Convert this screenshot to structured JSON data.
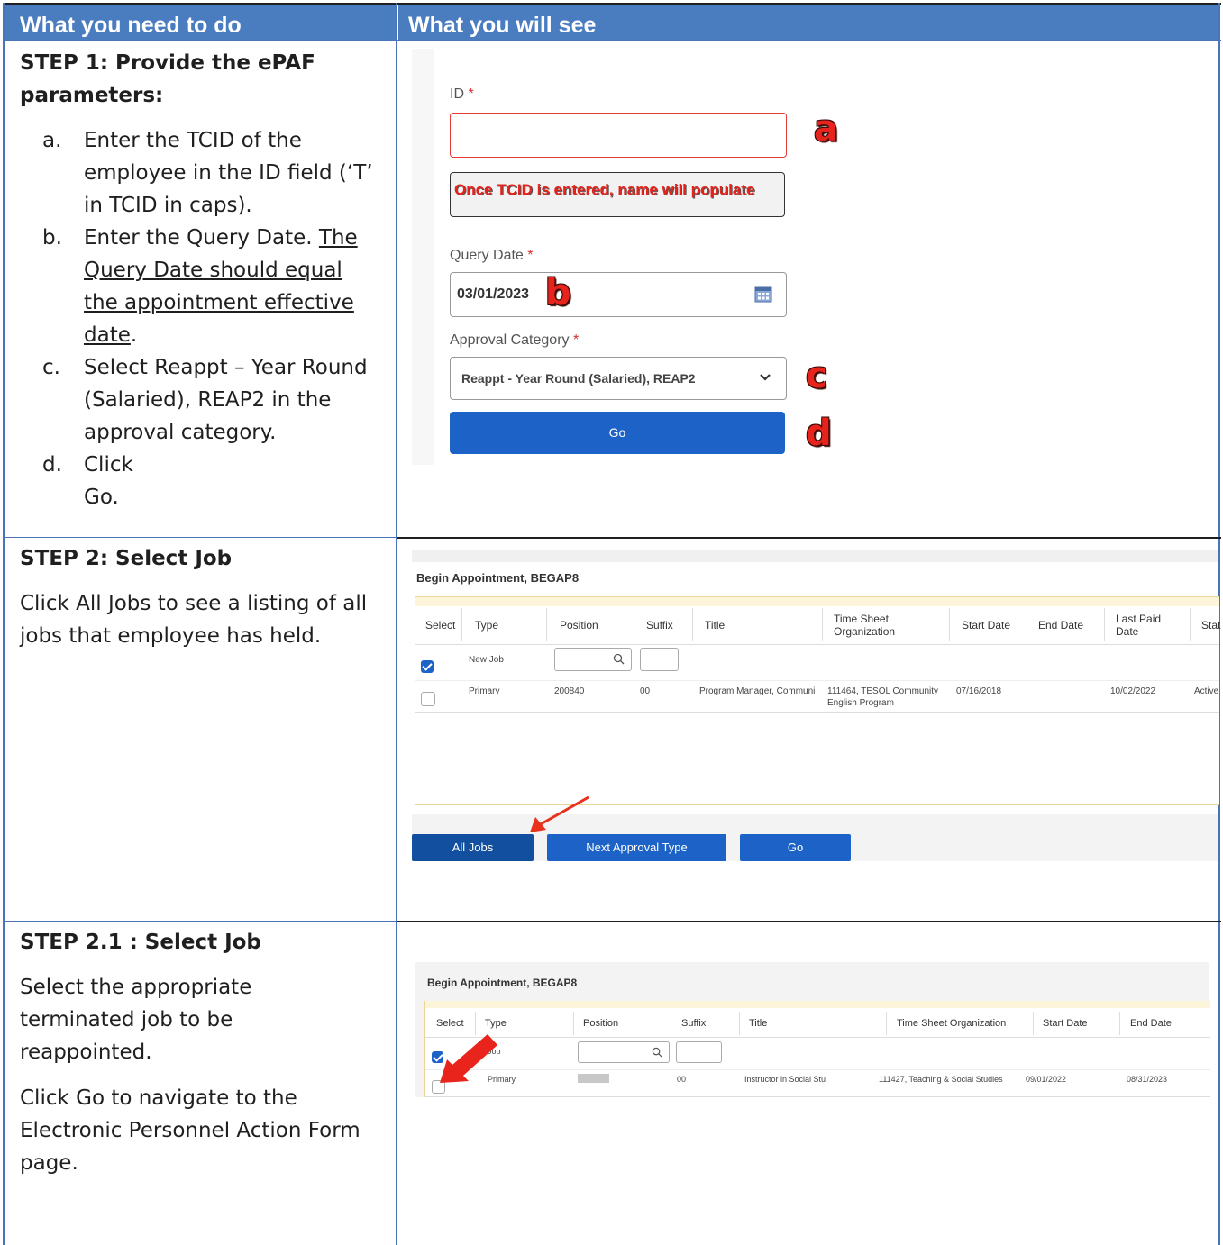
{
  "header": {
    "col1": "What you need to do",
    "col2": "What you will see"
  },
  "step1": {
    "title_line1": "STEP 1: Provide the ePAF",
    "title_line2": "parameters:",
    "items": [
      {
        "marker": "a.",
        "lines": [
          "Enter the TCID of the",
          "employee in the ID field (‘T’",
          "in TCID in caps)."
        ]
      },
      {
        "marker": "b.",
        "plain": "Enter the Query Date. ",
        "underlined": [
          "The",
          "Query Date should equal",
          "the appointment effective",
          "date"
        ],
        "end": "."
      },
      {
        "marker": "c.",
        "lines": [
          "Select Reappt – Year Round",
          "(Salaried), REAP2 in the",
          "approval category."
        ]
      },
      {
        "marker": "d.",
        "lines": [
          "Click Go."
        ]
      }
    ],
    "form": {
      "id_label": "ID",
      "required_mark": "*",
      "callout": "Once TCID is entered, name will populate",
      "query_date_label": "Query Date",
      "query_date_value": "03/01/2023",
      "approval_label": "Approval Category",
      "approval_value": "Reappt - Year Round (Salaried), REAP2",
      "go_label": "Go",
      "letters": [
        "a",
        "b",
        "c",
        "d"
      ],
      "icons": [
        "calendar-icon",
        "chevron-down-icon"
      ]
    }
  },
  "step2": {
    "title": "STEP 2: Select Job",
    "lines": [
      "Click All Jobs to see a listing of all",
      "jobs that employee has held."
    ],
    "screen": {
      "heading": "Begin Appointment, BEGAP8",
      "columns": [
        "Select",
        "Type",
        "Position",
        "Suffix",
        "Title",
        "Time Sheet",
        "Organization",
        "Start Date",
        "End Date",
        "Last Paid",
        "Date",
        "Stat"
      ],
      "new_job_label": "New Job",
      "row": {
        "type": "Primary",
        "position": "200840",
        "suffix": "00",
        "title": "Program Manager, Communi",
        "org_line1": "111464, TESOL Community",
        "org_line2": "English Program",
        "start": "07/16/2018",
        "last_paid": "10/02/2022",
        "status": "Active"
      },
      "buttons": [
        "All Jobs",
        "Next Approval Type",
        "Go"
      ]
    }
  },
  "step21": {
    "title": "STEP 2.1 : Select Job",
    "para1": [
      "Select the appropriate",
      "terminated job to be",
      "reappointed."
    ],
    "para2": [
      "Click Go to navigate to the",
      "Electronic Personnel Action Form",
      "page."
    ],
    "screen": {
      "heading": "Begin Appointment, BEGAP8",
      "columns": [
        "Select",
        "Type",
        "Position",
        "Suffix",
        "Title",
        "Time Sheet Organization",
        "Start Date",
        "End Date"
      ],
      "new_job_label": "Job",
      "row": {
        "type": "Primary",
        "suffix": "00",
        "title": "Instructor in Social Stu",
        "org": "111427, Teaching & Social Studies",
        "start": "09/01/2022",
        "end": "08/31/2023"
      }
    }
  },
  "colors": {
    "header_bg": "#4a7cc0",
    "button_blue": "#1d62c6",
    "annotation_red": "#e6231c"
  }
}
